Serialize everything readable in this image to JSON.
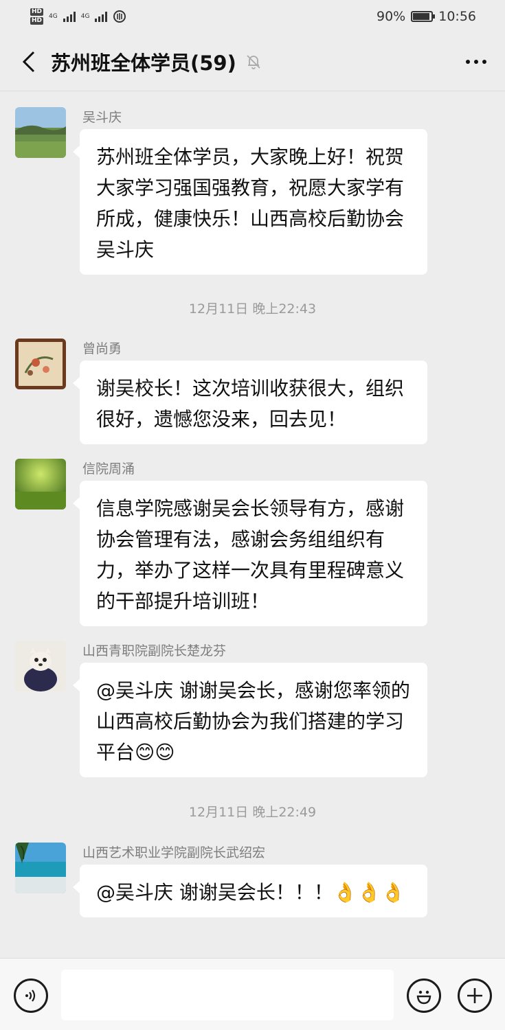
{
  "status": {
    "network_1": "4G",
    "network_2": "4G",
    "battery": "90%",
    "battery_level": 0.9,
    "time": "10:56"
  },
  "header": {
    "title": "苏州班全体学员(59)",
    "back_icon": "chevron-left-icon",
    "mute_icon": "bell-off-icon",
    "more_icon": "more-dots-icon"
  },
  "messages": [
    {
      "sender": "吴斗庆",
      "text": "苏州班全体学员，大家晚上好！祝贺大家学习强国强教育，祝愿大家学有所成，健康快乐！山西高校后勤协会吴斗庆"
    },
    {
      "sender": "曾尚勇",
      "text": "谢吴校长！这次培训收获很大，组织很好，遗憾您没来，回去见！"
    },
    {
      "sender": "信院周涌",
      "text": "信息学院感谢吴会长领导有方，感谢协会管理有法，感谢会务组组织有力，举办了这样一次具有里程碑意义的干部提升培训班！"
    },
    {
      "sender": "山西青职院副院长楚龙芬",
      "text": "@吴斗庆  谢谢吴会长，感谢您率领的山西高校后勤协会为我们搭建的学习平台😊😊"
    },
    {
      "sender": "山西艺术职业学院副院长武绍宏",
      "text": "@吴斗庆  谢谢吴会长！！！👌👌👌"
    }
  ],
  "timestamps": [
    "12月11日 晚上22:43",
    "12月11日 晚上22:49"
  ],
  "input": {
    "voice_icon": "voice-icon",
    "emoji_icon": "emoji-icon",
    "plus_icon": "plus-icon"
  }
}
